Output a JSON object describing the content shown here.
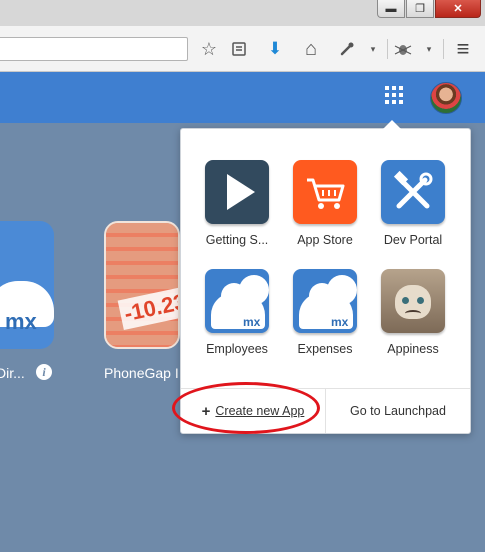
{
  "window": {
    "controls": {
      "minimize": "▬",
      "maximize": "❐",
      "close": "✕"
    }
  },
  "toolbar": {
    "icons": [
      "star-icon",
      "reading-list-icon",
      "download-icon",
      "home-icon",
      "dropper-icon",
      "firebug-icon",
      "menu-icon"
    ],
    "glyphs": {
      "star": "☆",
      "download": "⬇",
      "home": "⌂",
      "dropdown": "▾",
      "menu": "≡"
    }
  },
  "header": {
    "accent": "#3f7fd0"
  },
  "background": {
    "tiles": [
      {
        "label": "Dir...",
        "icon": "mx-cloud-icon",
        "badge": "mx"
      },
      {
        "label": "PhoneGap I",
        "icon": "stock-chart-icon",
        "price": "-10.23"
      }
    ],
    "info_glyph": "i"
  },
  "launcher": {
    "apps": [
      {
        "label": "Getting S...",
        "icon": "play-icon",
        "color": "#324a5e"
      },
      {
        "label": "App Store",
        "icon": "cart-icon",
        "color": "#ff5a1f"
      },
      {
        "label": "Dev Portal",
        "icon": "tools-icon",
        "color": "#3d7fcc"
      },
      {
        "label": "Employees",
        "icon": "mx-cloud-icon",
        "color": "#3d7fcc",
        "badge": "mx"
      },
      {
        "label": "Expenses",
        "icon": "mx-cloud-icon",
        "color": "#3d7fcc",
        "badge": "mx"
      },
      {
        "label": "Appiness",
        "icon": "grumpy-cat-icon"
      }
    ],
    "footer": {
      "create_plus": "+",
      "create_label": "Create new App",
      "launchpad_label": "Go to Launchpad"
    }
  },
  "annotation": {
    "highlight_color": "#e0151c"
  }
}
